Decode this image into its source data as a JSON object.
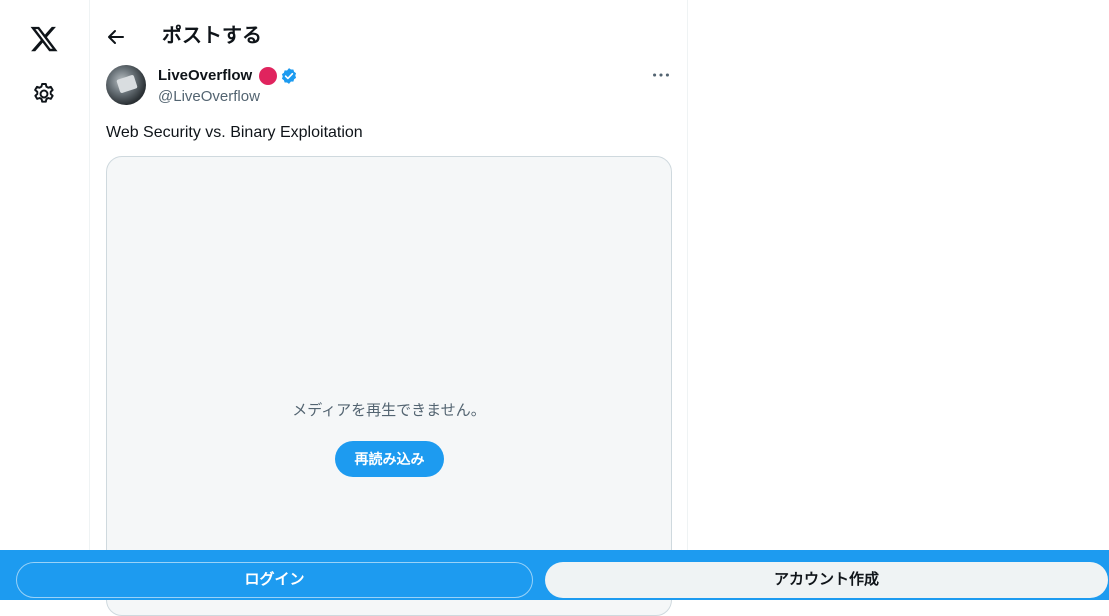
{
  "nav": {
    "logo_icon": "x-logo-icon",
    "settings_icon": "gear-icon"
  },
  "header": {
    "back_icon": "arrow-left-icon",
    "title": "ポストする"
  },
  "post": {
    "author": {
      "name": "LiveOverflow",
      "handle": "@LiveOverflow",
      "badge_color": "#e0245e",
      "verified_color": "#1d9bf0"
    },
    "more_icon": "more-horizontal-icon",
    "text": "Web Security vs. Binary Exploitation",
    "media": {
      "message": "メディアを再生できません。",
      "reload_label": "再読み込み"
    }
  },
  "bottom_bar": {
    "login_label": "ログイン",
    "signup_label": "アカウント作成",
    "accent_color": "#1d9bf0"
  }
}
